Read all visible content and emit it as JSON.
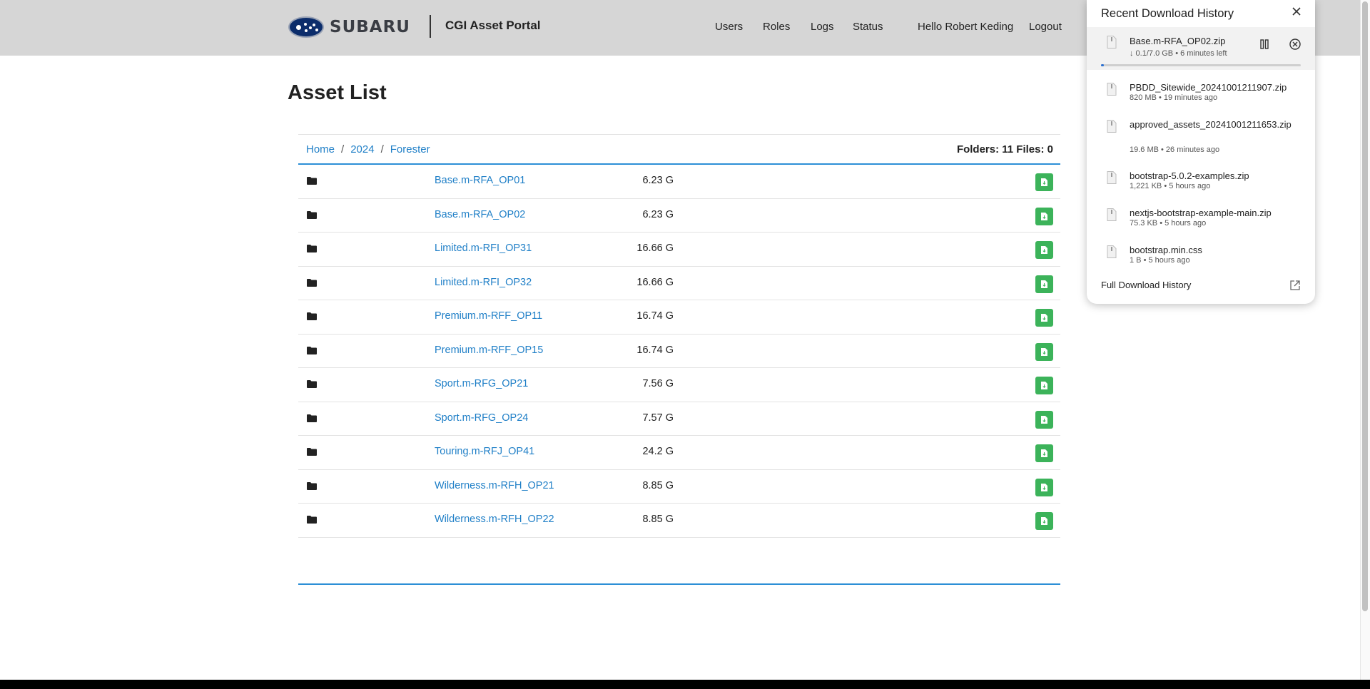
{
  "brand": {
    "logo_text": "SUBARU",
    "portal_title": "CGI Asset Portal"
  },
  "nav": {
    "users": "Users",
    "roles": "Roles",
    "logs": "Logs",
    "status": "Status",
    "greeting": "Hello Robert Keding",
    "logout": "Logout"
  },
  "page": {
    "title": "Asset List"
  },
  "breadcrumb": [
    {
      "label": "Home"
    },
    {
      "label": "2024"
    },
    {
      "label": "Forester"
    }
  ],
  "breadcrumb_sep": "/",
  "counts": "Folders: 11 Files: 0",
  "assets": [
    {
      "name": "Base.m-RFA_OP01",
      "size": "6.23 G"
    },
    {
      "name": "Base.m-RFA_OP02",
      "size": "6.23 G"
    },
    {
      "name": "Limited.m-RFI_OP31",
      "size": "16.66 G"
    },
    {
      "name": "Limited.m-RFI_OP32",
      "size": "16.66 G"
    },
    {
      "name": "Premium.m-RFF_OP11",
      "size": "16.74 G"
    },
    {
      "name": "Premium.m-RFF_OP15",
      "size": "16.74 G"
    },
    {
      "name": "Sport.m-RFG_OP21",
      "size": "7.56 G"
    },
    {
      "name": "Sport.m-RFG_OP24",
      "size": "7.57 G"
    },
    {
      "name": "Touring.m-RFJ_OP41",
      "size": "24.2 G"
    },
    {
      "name": "Wilderness.m-RFH_OP21",
      "size": "8.85 G"
    },
    {
      "name": "Wilderness.m-RFH_OP22",
      "size": "8.85 G"
    }
  ],
  "downloads": {
    "title": "Recent Download History",
    "items": [
      {
        "name": "Base.m-RFA_OP02.zip",
        "meta": "↓ 0.1/7.0 GB • 6 minutes left",
        "active": true,
        "progress": 0.014
      },
      {
        "name": "PBDD_Sitewide_20241001211907.zip",
        "meta": "820 MB • 19 minutes ago"
      },
      {
        "name": "approved_assets_20241001211653.zip",
        "meta": "19.6 MB • 26 minutes ago"
      },
      {
        "name": "bootstrap-5.0.2-examples.zip",
        "meta": "1,221 KB • 5 hours ago"
      },
      {
        "name": "nextjs-bootstrap-example-main.zip",
        "meta": "75.3 KB • 5 hours ago"
      },
      {
        "name": "bootstrap.min.css",
        "meta": "1 B • 5 hours ago"
      }
    ],
    "full_history": "Full Download History"
  },
  "colors": {
    "header_bg": "#d6d6d6",
    "link": "#1f7fc7",
    "accent_line": "#2c8fd6",
    "download_green": "#3cb35a",
    "progress": "#2a6fd1"
  }
}
